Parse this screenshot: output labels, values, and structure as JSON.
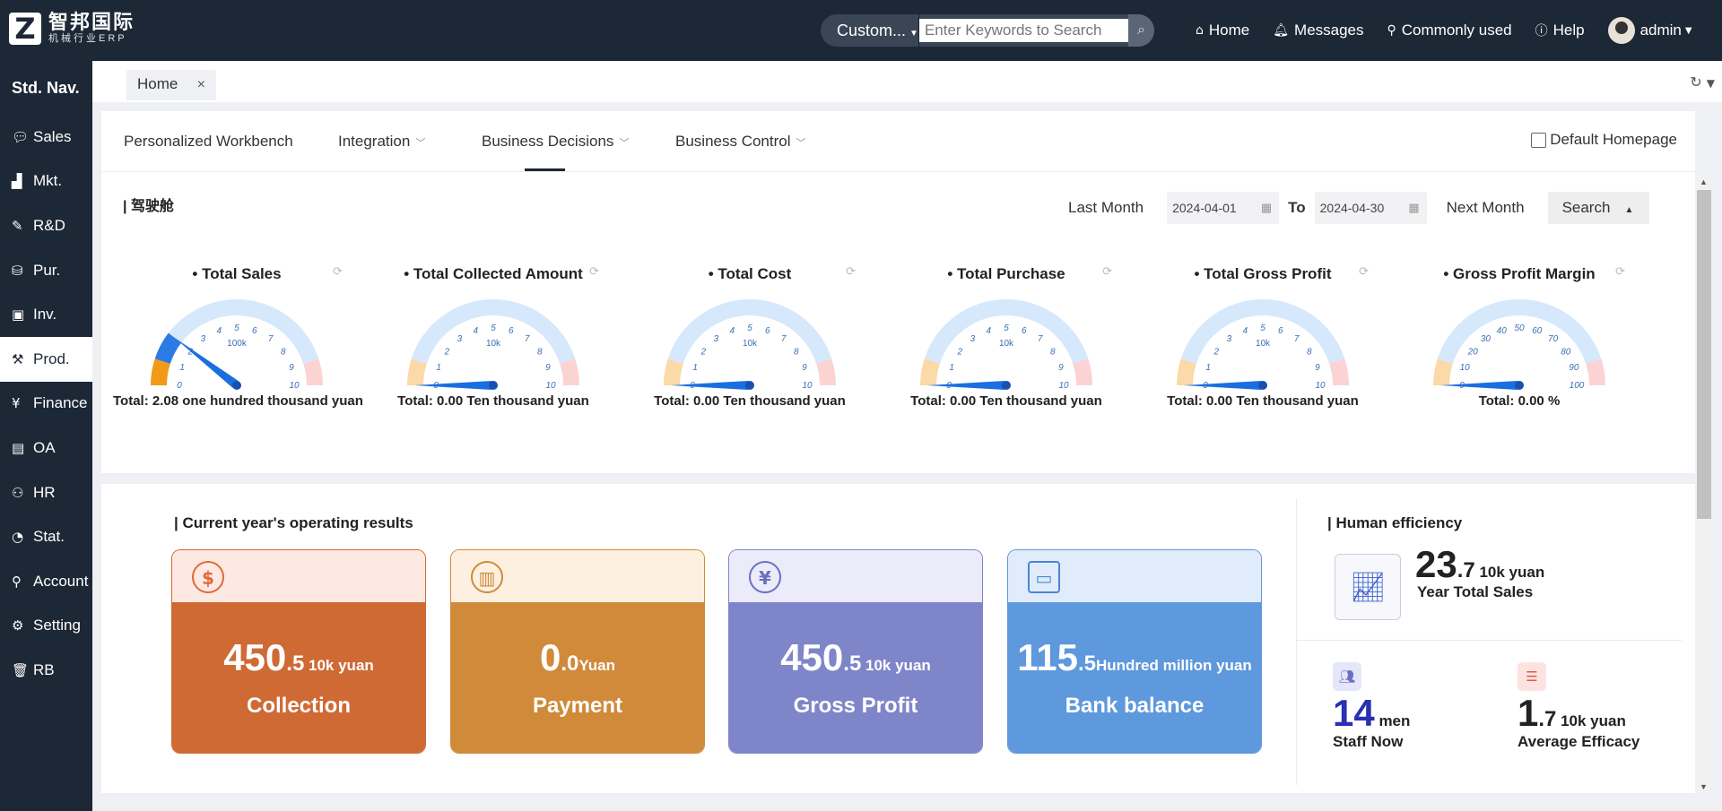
{
  "app": {
    "logo_letter": "Z",
    "logo_cn": "智邦国际",
    "logo_sub": "机械行业ERP"
  },
  "search": {
    "mode": "Custom...",
    "placeholder": "Enter Keywords to Search"
  },
  "topnav": {
    "home": "Home",
    "messages": "Messages",
    "common": "Commonly used",
    "help": "Help",
    "user": "admin"
  },
  "sidebar": {
    "title": "Std. Nav.",
    "items": [
      {
        "label": "Sales",
        "icon": "chat-icon"
      },
      {
        "label": "Mkt.",
        "icon": "bar-chart-icon"
      },
      {
        "label": "R&D",
        "icon": "pen-icon"
      },
      {
        "label": "Pur.",
        "icon": "basket-icon"
      },
      {
        "label": "Inv.",
        "icon": "inventory-icon"
      },
      {
        "label": "Prod.",
        "icon": "hammer-icon"
      },
      {
        "label": "Finance",
        "icon": "yen-icon"
      },
      {
        "label": "OA",
        "icon": "briefcase-icon"
      },
      {
        "label": "HR",
        "icon": "people-icon"
      },
      {
        "label": "Stat.",
        "icon": "pie-icon"
      },
      {
        "label": "Account",
        "icon": "user-icon"
      },
      {
        "label": "Setting",
        "icon": "gear-icon"
      },
      {
        "label": "RB",
        "icon": "trash-icon"
      }
    ]
  },
  "tabs": {
    "home": "Home"
  },
  "subnav": {
    "items": [
      "Personalized Workbench",
      "Integration",
      "Business Decisions",
      "Business Control"
    ],
    "default_home": "Default Homepage"
  },
  "cockpit": {
    "title": "| 驾驶舱",
    "last_month": "Last Month",
    "from": "2024-04-01",
    "to_label": "To",
    "to": "2024-04-30",
    "next_month": "Next Month",
    "search": "Search"
  },
  "gauges": [
    {
      "title": "• Total Sales",
      "unit_label": "100k",
      "ticks": [
        "0",
        "1",
        "2",
        "3",
        "4",
        "5",
        "6",
        "7",
        "8",
        "9",
        "10"
      ],
      "value": 2.08,
      "max": 10,
      "total": "Total:  2.08 one hundred thousand yuan"
    },
    {
      "title": "• Total Collected Amount",
      "unit_label": "10k",
      "ticks": [
        "0",
        "1",
        "2",
        "3",
        "4",
        "5",
        "6",
        "7",
        "8",
        "9",
        "10"
      ],
      "value": 0,
      "max": 10,
      "total": "Total:  0.00 Ten thousand yuan"
    },
    {
      "title": "• Total Cost",
      "unit_label": "10k",
      "ticks": [
        "0",
        "1",
        "2",
        "3",
        "4",
        "5",
        "6",
        "7",
        "8",
        "9",
        "10"
      ],
      "value": 0,
      "max": 10,
      "total": "Total:  0.00 Ten thousand yuan"
    },
    {
      "title": "• Total Purchase",
      "unit_label": "10k",
      "ticks": [
        "0",
        "1",
        "2",
        "3",
        "4",
        "5",
        "6",
        "7",
        "8",
        "9",
        "10"
      ],
      "value": 0,
      "max": 10,
      "total": "Total:  0.00 Ten thousand yuan"
    },
    {
      "title": "• Total Gross Profit",
      "unit_label": "10k",
      "ticks": [
        "0",
        "1",
        "2",
        "3",
        "4",
        "5",
        "6",
        "7",
        "8",
        "9",
        "10"
      ],
      "value": 0,
      "max": 10,
      "total": "Total:  0.00 Ten thousand yuan"
    },
    {
      "title": "• Gross Profit Margin",
      "unit_label": "",
      "ticks": [
        "0",
        "10",
        "20",
        "30",
        "40",
        "50",
        "60",
        "70",
        "80",
        "90",
        "100"
      ],
      "value": 0,
      "max": 100,
      "total": "Total:  0.00 %"
    }
  ],
  "results": {
    "title": "| Current year's operating results",
    "cards": [
      {
        "int": "450",
        "dec": ".5",
        "unit": " 10k yuan",
        "label": "Collection",
        "icon": "dollar-circle-icon",
        "head": "#fde8e2",
        "body": "#cf6a35",
        "ic": "#e06a3a"
      },
      {
        "int": "0",
        "dec": ".0",
        "unit": "Yuan",
        "label": "Payment",
        "icon": "payment-doc-icon",
        "head": "#fdf0e1",
        "body": "#d08a39",
        "ic": "#d08a39"
      },
      {
        "int": "450",
        "dec": ".5",
        "unit": " 10k yuan",
        "label": "Gross Profit",
        "icon": "yen-circle-icon",
        "head": "#ebebfa",
        "body": "#7f85c9",
        "ic": "#6a6fc0"
      },
      {
        "int": "115",
        "dec": ".5",
        "unit": "Hundred million yuan",
        "label": "Bank balance",
        "icon": "wallet-icon",
        "head": "#e0ecfc",
        "body": "#5e98dd",
        "ic": "#4a86d4"
      }
    ]
  },
  "efficiency": {
    "title": "| Human efficiency",
    "sales_int": "23",
    "sales_dec": ".7",
    "sales_unit": " 10k yuan",
    "sales_label": "Year Total Sales",
    "staff_int": "14",
    "staff_unit": " men",
    "staff_label": "Staff Now",
    "avg_int": "1",
    "avg_dec": ".7",
    "avg_unit": " 10k yuan",
    "avg_label": "Average Efficacy"
  }
}
